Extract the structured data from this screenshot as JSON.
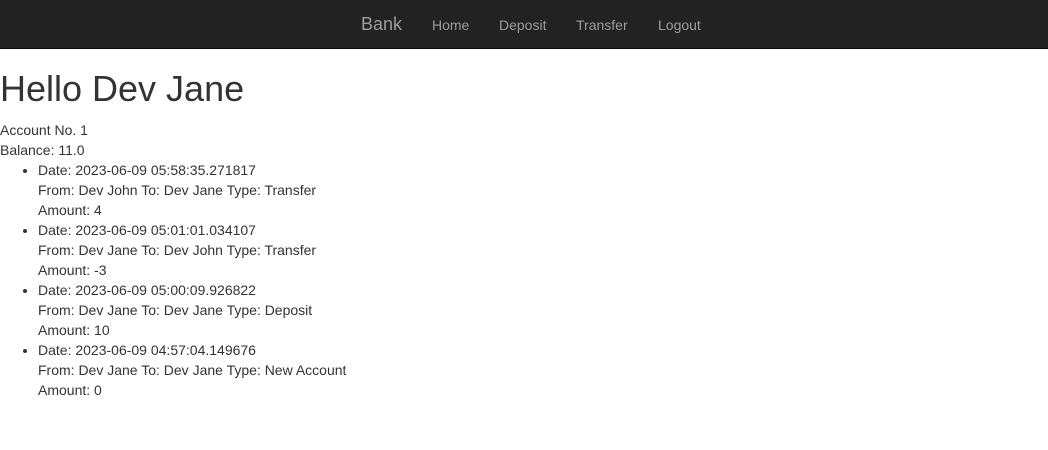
{
  "nav": {
    "brand": "Bank",
    "home": "Home",
    "deposit": "Deposit",
    "transfer": "Transfer",
    "logout": "Logout"
  },
  "greeting": "Hello Dev Jane",
  "account": {
    "number_text": "Account No. 1",
    "balance_text": "Balance: 11.0"
  },
  "transactions": [
    {
      "date_text": "Date: 2023-06-09 05:58:35.271817",
      "parties_text": "From: Dev John To: Dev Jane Type: Transfer",
      "amount_text": "Amount: 4"
    },
    {
      "date_text": "Date: 2023-06-09 05:01:01.034107",
      "parties_text": "From: Dev Jane To: Dev John Type: Transfer",
      "amount_text": "Amount: -3"
    },
    {
      "date_text": "Date: 2023-06-09 05:00:09.926822",
      "parties_text": "From: Dev Jane To: Dev Jane Type: Deposit",
      "amount_text": "Amount: 10"
    },
    {
      "date_text": "Date: 2023-06-09 04:57:04.149676",
      "parties_text": "From: Dev Jane To: Dev Jane Type: New Account",
      "amount_text": "Amount: 0"
    }
  ],
  "colors": {
    "navbar_bg": "#222222",
    "nav_text": "#9d9d9d",
    "body_text": "#333333",
    "page_bg": "#ffffff"
  }
}
